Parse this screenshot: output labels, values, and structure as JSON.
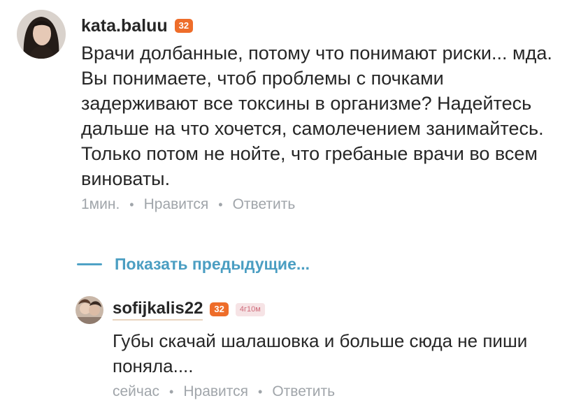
{
  "comment": {
    "username": "kata.baluu",
    "badge": "32",
    "text": "Врачи долбанные, потому что понимают риски... мда. Вы понимаете, чтоб проблемы с почками задерживают все токсины в организме? Надейтесь дальше на что хочется, самолечением занимайтесь. Только потом не нойте, что гребаные врачи во всем виноваты.",
    "time": "1мин.",
    "like_label": "Нравится",
    "reply_label": "Ответить"
  },
  "show_previous": {
    "label": "Показать предыдущие..."
  },
  "reply": {
    "username": "sofijkalis22",
    "badge": "32",
    "tag": "4г10м",
    "text": "Губы скачай шалашовка и больше сюда не пиши поняла....",
    "time": "сейчас",
    "like_label": "Нравится",
    "reply_label": "Ответить"
  },
  "colors": {
    "badge_orange": "#ee6d2a",
    "link_blue": "#4b9ec2",
    "meta_gray": "#a0a5aa",
    "tag_pink": "#f6e3e5"
  }
}
